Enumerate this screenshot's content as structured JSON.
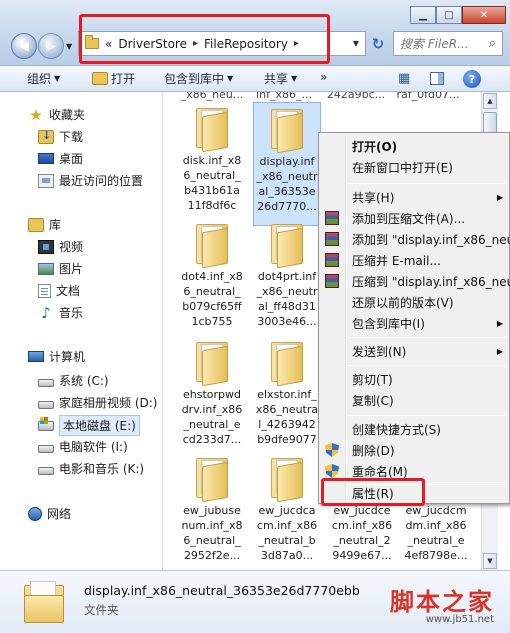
{
  "window": {
    "minimize_glyph": "▁",
    "maximize_glyph": "□",
    "close_glyph": "✕"
  },
  "address": {
    "chevron": "«",
    "crumbs": [
      "DriverStore",
      "FileRepository"
    ],
    "separator": "▸"
  },
  "search": {
    "placeholder": "搜索 FileR..."
  },
  "toolbar": {
    "organize": "组织",
    "open": "打开",
    "include_in_library": "包含到库中",
    "share": "共享",
    "more": "»"
  },
  "nav": {
    "favorites": "收藏夹",
    "downloads": "下载",
    "desktop": "桌面",
    "recent": "最近访问的位置",
    "libraries": "库",
    "videos": "视频",
    "pictures": "图片",
    "documents": "文档",
    "music": "音乐",
    "computer": "计算机",
    "drives": [
      "系统 (C:)",
      "家庭相册视频 (D:)",
      "本地磁盘 (E:)",
      "电脑软件 (I:)",
      "电影和音乐 (K:)"
    ],
    "network": "网络"
  },
  "files": {
    "top_cut": [
      "_x86_neu...",
      "inf_x86_...",
      "242a9bc...",
      "raf_0fd07..."
    ],
    "items": [
      [
        "disk.inf_x8",
        "6_neutral_",
        "b431b61a",
        "11f8df6c"
      ],
      [
        "display.inf",
        "_x86_neutr",
        "al_36353e",
        "26d7770..."
      ],
      [
        "dot4.inf_x8",
        "6_neutral_",
        "b079cf65ff",
        "1cb755"
      ],
      [
        "dot4prt.inf",
        "_x86_neutr",
        "al_ff48d31",
        "3003e46..."
      ],
      [
        "ehstorpwd",
        "drv.inf_x86",
        "_neutral_e",
        "cd233d7..."
      ],
      [
        "elxstor.inf_",
        "x86_neutra",
        "l_4263942",
        "b9dfe9077"
      ],
      [
        "ew_jubuse",
        "num.inf_x8",
        "6_neutral_",
        "2952f2e..."
      ],
      [
        "ew_jucdca",
        "cm.inf_x86",
        "_neutral_b",
        "3d87a0..."
      ],
      [
        "ew_jucdce",
        "cm.inf_x86",
        "_neutral_2",
        "9499e67..."
      ],
      [
        "ew_jucdcm",
        "dm.inf_x86",
        "_neutral_e",
        "4ef8798e..."
      ]
    ]
  },
  "context_menu": {
    "open": "打开(O)",
    "open_new_window": "在新窗口中打开(E)",
    "share": "共享(H)",
    "add_to_archive": "添加到压缩文件(A)...",
    "add_to_named": "添加到 \"display.inf_x86_neutr",
    "compress_email": "压缩并 E-mail...",
    "compress_to_named": "压缩到 \"display.inf_x86_neut",
    "restore_previous": "还原以前的版本(V)",
    "include_in_library": "包含到库中(I)",
    "send_to": "发送到(N)",
    "cut": "剪切(T)",
    "copy": "复制(C)",
    "create_shortcut": "创建快捷方式(S)",
    "delete": "删除(D)",
    "rename": "重命名(M)",
    "properties": "属性(R)",
    "submenu_arrow": "▶"
  },
  "details": {
    "name": "display.inf_x86_neutral_36353e26d7770ebb",
    "type": "文件夹"
  },
  "watermark": {
    "title": "脚本之家",
    "url": "www.jb51.net"
  }
}
